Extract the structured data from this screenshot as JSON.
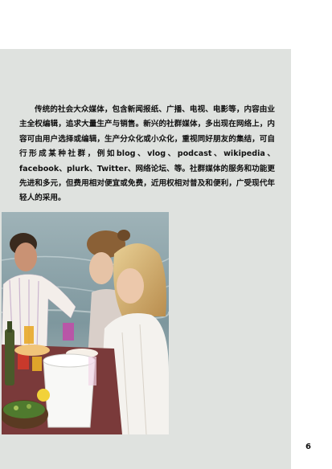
{
  "body": {
    "paragraph": "传统的社会大众媒体，包含新闻报纸、广播、电视、电影等，内容由业主全权编辑，追求大量生产与销售。新兴的社群媒体，多出现在网络上，内容可由用户选择或编辑，生产分众化或小众化，重视同好朋友的集结，可自行形成某种社群，例如blog、vlog、podcast、wikipedia、facebook、plurk、Twitter、网络论坛、等。社群媒体的服务和功能更先进和多元，但费用相对便宜或免费，近用权相对普及和便利，广受现代年轻人的采用。"
  },
  "footer": {
    "page_number": "6"
  },
  "colors": {
    "panel": "#dfe2df",
    "text": "#111111"
  }
}
